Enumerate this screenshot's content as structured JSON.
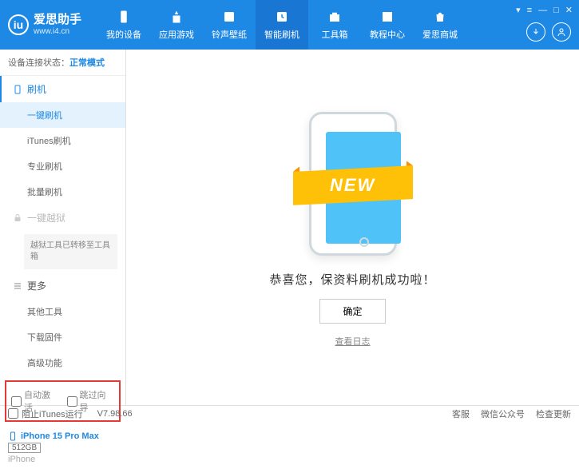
{
  "app": {
    "title": "爱思助手",
    "url": "www.i4.cn"
  },
  "titlebar": {
    "menu": "▾",
    "list": "≡",
    "min": "—",
    "max": "□",
    "close": "✕"
  },
  "nav": [
    {
      "label": "我的设备"
    },
    {
      "label": "应用游戏"
    },
    {
      "label": "铃声壁纸"
    },
    {
      "label": "智能刷机"
    },
    {
      "label": "工具箱"
    },
    {
      "label": "教程中心"
    },
    {
      "label": "爱思商城"
    }
  ],
  "status": {
    "label": "设备连接状态：",
    "value": "正常模式"
  },
  "sidebar": {
    "flash": "刷机",
    "items1": [
      "一键刷机",
      "iTunes刷机",
      "专业刷机",
      "批量刷机"
    ],
    "jailbreak": "一键越狱",
    "note": "越狱工具已转移至工具箱",
    "more": "更多",
    "items2": [
      "其他工具",
      "下载固件",
      "高级功能"
    ],
    "cb1": "自动激活",
    "cb2": "跳过向导"
  },
  "device": {
    "name": "iPhone 15 Pro Max",
    "storage": "512GB",
    "type": "iPhone"
  },
  "main": {
    "new": "NEW",
    "msg": "恭喜您，保资料刷机成功啦！",
    "ok": "确定",
    "log": "查看日志"
  },
  "footer": {
    "block": "阻止iTunes运行",
    "version": "V7.98.66",
    "r1": "客服",
    "r2": "微信公众号",
    "r3": "检查更新"
  }
}
